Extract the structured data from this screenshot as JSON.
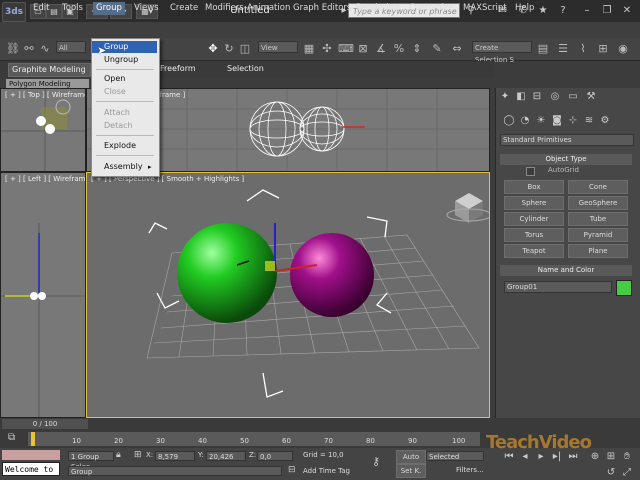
{
  "app": {
    "logo": "3ds",
    "title": "Untitled"
  },
  "quick_access": {
    "icons": [
      "new-icon",
      "open-icon",
      "save-icon",
      "undo-icon",
      "redo-icon",
      "project-icon"
    ]
  },
  "search": {
    "placeholder": "Type a keyword or phrase"
  },
  "menu": {
    "items": [
      "Edit",
      "Tools",
      "Group",
      "Views",
      "Create",
      "Modifiers",
      "Animation",
      "Graph Editors",
      "Rendering",
      "Customize",
      "MAXScript",
      "Help"
    ]
  },
  "toolbar": {
    "selection_filter": "All",
    "view_combo": "View",
    "selection_set": "Create Selection S"
  },
  "ribbon": {
    "tabs": [
      "Graphite Modeling",
      "Freeform",
      "Selection"
    ],
    "poly_tab": "Polygon Modeling"
  },
  "viewports": {
    "top": "[ + ] [ Top ] [ Wireframe ]",
    "front": "[ + ] [ Front ] [ Wireframe ]",
    "left": "[ + ] [ Left ] [ Wireframe ]",
    "perspective": "[ + ] [ Perspective ] [ Smooth + Highlights ]"
  },
  "dropdown": {
    "group": "Group",
    "ungroup": "Ungroup",
    "open": "Open",
    "close": "Close",
    "attach": "Attach",
    "detach": "Detach",
    "explode": "Explode",
    "assembly": "Assembly"
  },
  "cmdpanel": {
    "category": "Standard Primitives",
    "object_type": "Object Type",
    "autogrid": "AutoGrid",
    "buttons": [
      "Box",
      "Cone",
      "Sphere",
      "GeoSphere",
      "Cylinder",
      "Tube",
      "Torus",
      "Pyramid",
      "Teapot",
      "Plane"
    ],
    "name_color": "Name and Color",
    "object_name": "Group01",
    "object_color": "#44cc44"
  },
  "timeline": {
    "frame": "0 / 100",
    "ticks": [
      "0",
      "10",
      "20",
      "30",
      "40",
      "50",
      "60",
      "70",
      "80",
      "90",
      "100"
    ]
  },
  "status": {
    "script": "Welcome to",
    "selection": "1 Group Selec",
    "prompt": "Group",
    "x_label": "X:",
    "x_value": "8,579",
    "y_label": "Y:",
    "y_value": "20,426",
    "z_label": "Z:",
    "z_value": "0,0",
    "grid": "Grid = 10,0",
    "add_time_tag": "Add Time Tag",
    "auto": "Auto",
    "selected": "Selected",
    "set_key": "Set K.",
    "filters": "Filters..."
  },
  "watermark": "TeachVideo"
}
